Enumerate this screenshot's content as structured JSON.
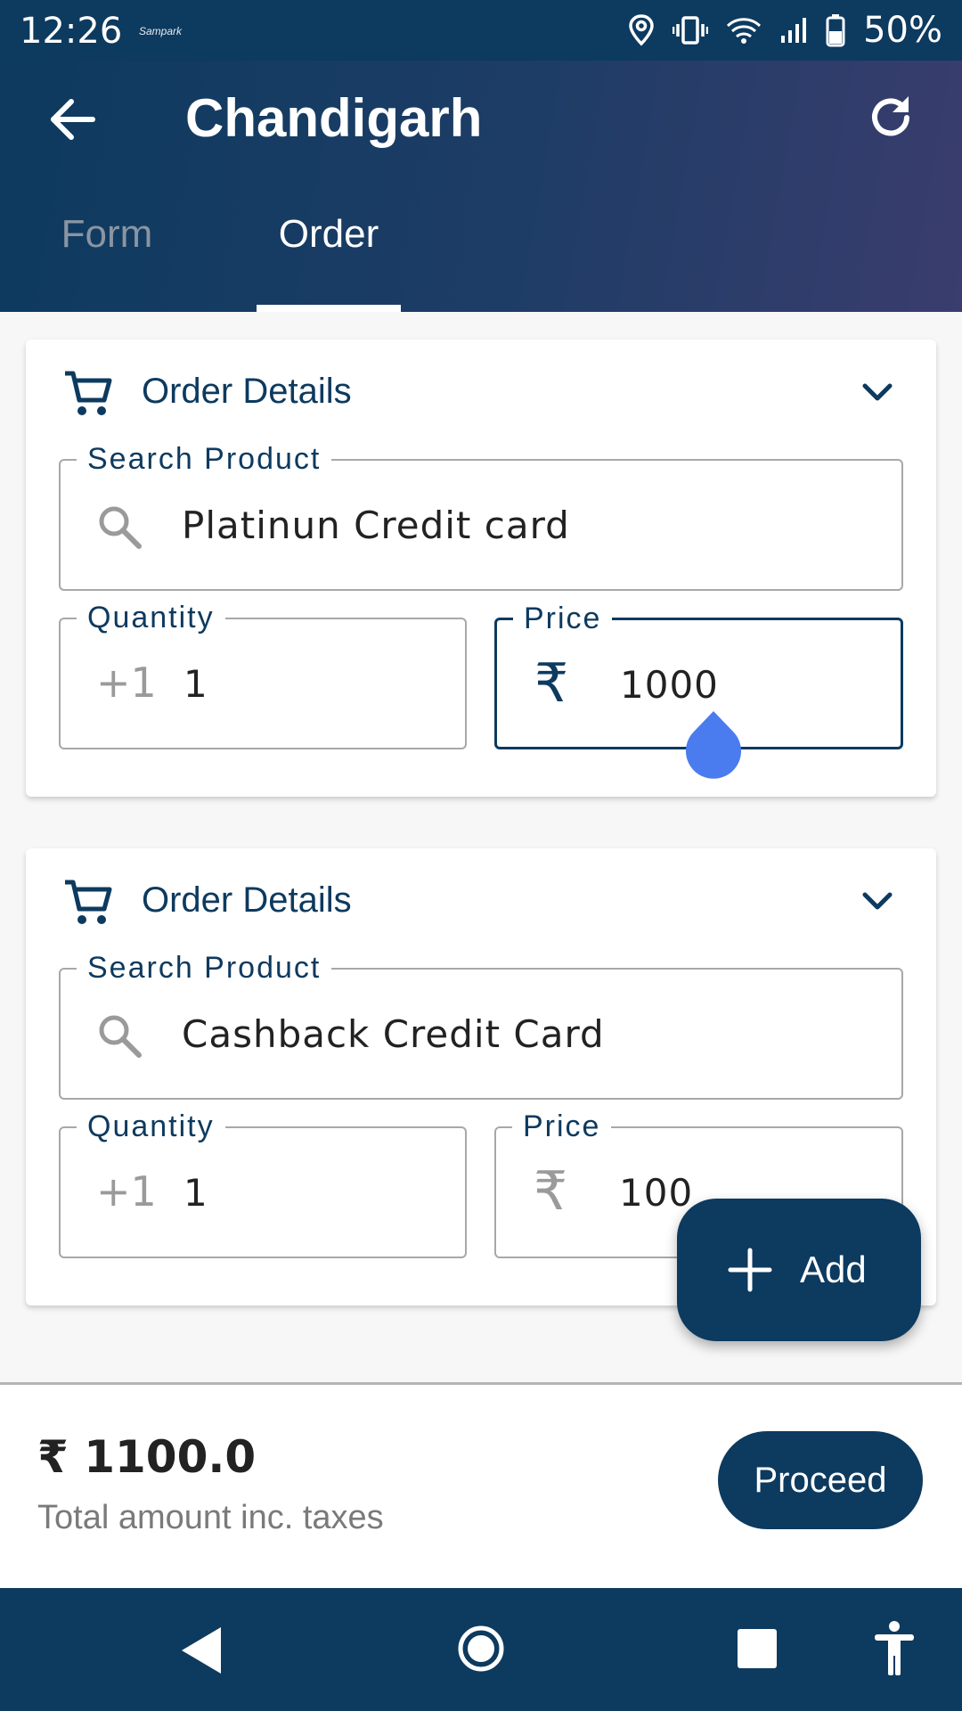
{
  "status_bar": {
    "time": "12:26",
    "app_notification": "Sampark",
    "battery": "50%"
  },
  "app_bar": {
    "title": "Chandigarh",
    "tabs": [
      {
        "label": "Form",
        "selected": false
      },
      {
        "label": "Order",
        "selected": true
      }
    ]
  },
  "orders": [
    {
      "title": "Order Details",
      "search_label": "Search Product",
      "product": "Platinun Credit card",
      "quantity_label": "Quantity",
      "quantity_prefix": "+1",
      "quantity": "1",
      "price_label": "Price",
      "price_prefix": "₹",
      "price": "1000"
    },
    {
      "title": "Order Details",
      "search_label": "Search Product",
      "product": "Cashback Credit Card",
      "quantity_label": "Quantity",
      "quantity_prefix": "+1",
      "quantity": "1",
      "price_label": "Price",
      "price_prefix": "₹",
      "price": "100"
    }
  ],
  "fab": {
    "label": "Add",
    "icon": "plus-icon"
  },
  "summary": {
    "total": "₹ 1100.0",
    "caption": "Total amount inc. taxes",
    "proceed_label": "Proceed"
  },
  "colors": {
    "primary": "#0d3a5f",
    "cursor_handle": "#4a7cf0"
  }
}
